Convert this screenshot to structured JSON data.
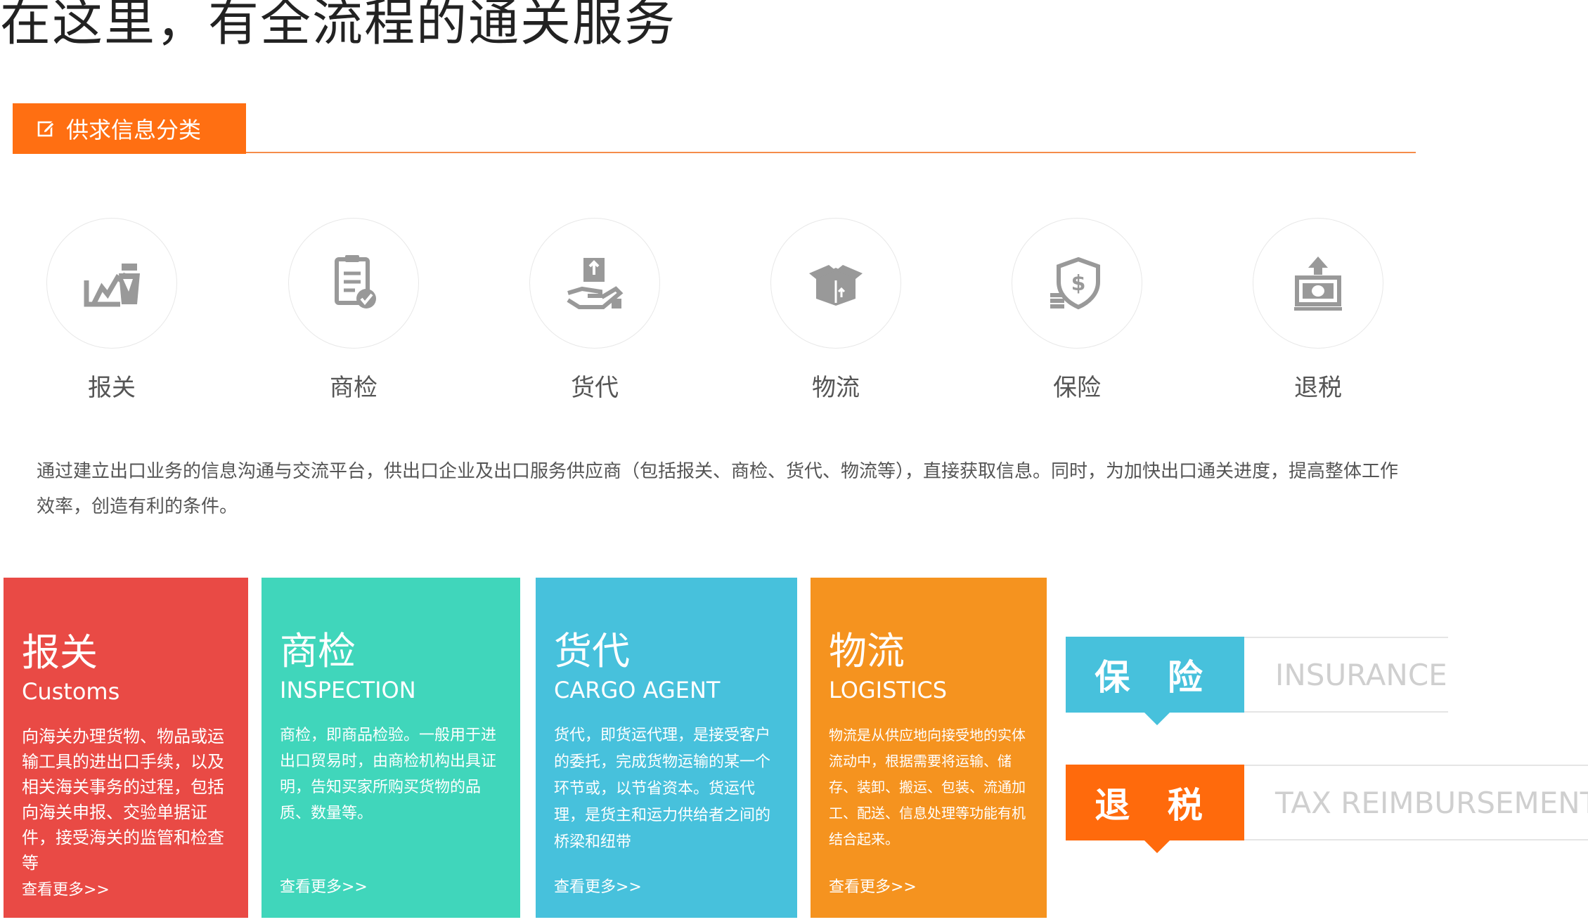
{
  "page_title": "在这里，有全流程的通关服务",
  "section": {
    "tab_label": "供求信息分类",
    "tab_icon": "edit-icon"
  },
  "categories": [
    {
      "label": "报关",
      "icon": "customs-declaration-icon"
    },
    {
      "label": "商检",
      "icon": "inspection-clipboard-icon"
    },
    {
      "label": "货代",
      "icon": "cargo-hand-icon"
    },
    {
      "label": "物流",
      "icon": "logistics-box-icon"
    },
    {
      "label": "保险",
      "icon": "insurance-shield-icon"
    },
    {
      "label": "退税",
      "icon": "tax-refund-icon"
    }
  ],
  "intro_text": "通过建立出口业务的信息沟通与交流平台，供出口企业及出口服务供应商（包括报关、商检、货代、物流等），直接获取信息。同时，为加快出口通关进度，提高整体工作效率，创造有利的条件。",
  "cards": [
    {
      "title": "报关",
      "subtitle": "Customs",
      "desc": "向海关办理货物、物品或运输工具的进出口手续，以及相关海关事务的过程，包括向海关申报、交验单据证件，接受海关的监管和检查等",
      "more": "查看更多>>",
      "color": "#e94a45"
    },
    {
      "title": "商检",
      "subtitle": "INSPECTION",
      "desc": "商检，即商品检验。一般用于进出口贸易时，由商检机构出具证明，告知买家所购买货物的品质、数量等。",
      "more": "查看更多>>",
      "color": "#40d6bb"
    },
    {
      "title": "货代",
      "subtitle": "CARGO AGENT",
      "desc": "货代，即货运代理，是接受客户的委托，完成货物运输的某一个环节或，以节省资本。货运代理，是货主和运力供给者之间的桥梁和纽带",
      "more": "查看更多>>",
      "color": "#47c1dc"
    },
    {
      "title": "物流",
      "subtitle": "LOGISTICS",
      "desc": "物流是从供应地向接受地的实体流动中，根据需要将运输、储存、装卸、搬运、包装、流通加工、配送、信息处理等功能有机结合起来。",
      "more": "查看更多>>",
      "color": "#f5931f"
    }
  ],
  "badges": [
    {
      "label": "保 险",
      "english": "INSURANCE",
      "color": "#47c1dc"
    },
    {
      "label": "退 税",
      "english": "TAX REIMBURSEMENT",
      "color": "#ff6a0c"
    }
  ]
}
